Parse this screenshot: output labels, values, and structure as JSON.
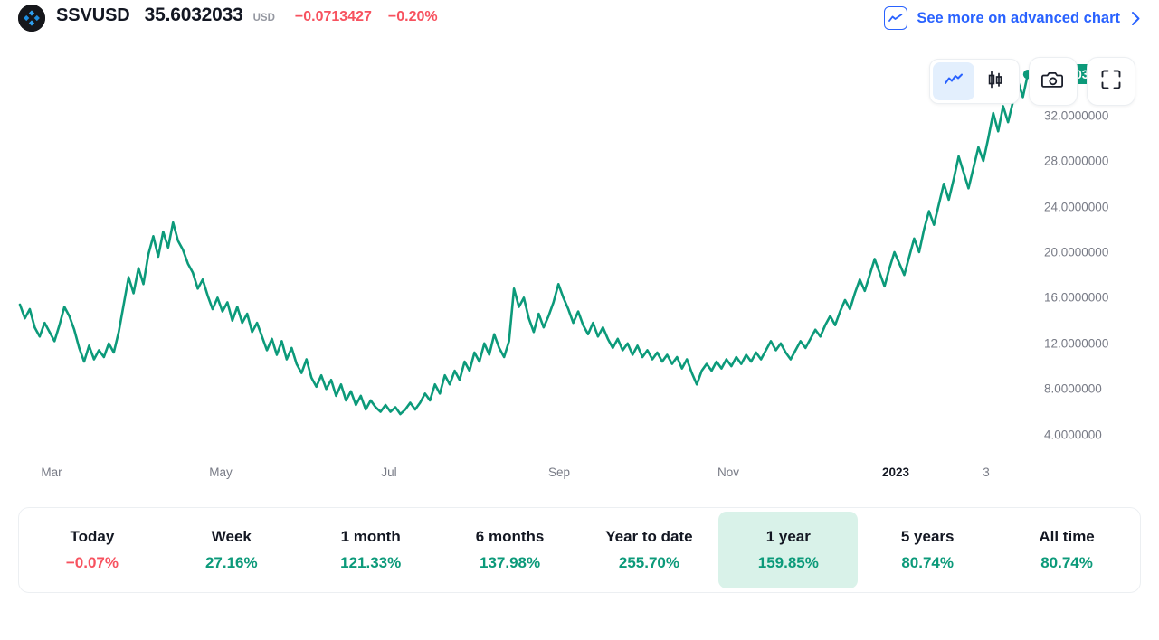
{
  "header": {
    "logo_icon": "ssv-diamond-logo-icon",
    "ticker": "SSVUSD",
    "last_price": "35.6032033",
    "currency": "USD",
    "change_abs": "−0.0713427",
    "change_pct": "−0.20%",
    "change_direction": "negative",
    "advanced_link_label": "See more on advanced chart",
    "advanced_link_icon": "line-chart-icon",
    "advanced_chevron_icon": "chevron-right-icon",
    "link_color": "#2962ff",
    "negative_color": "#f7525f"
  },
  "toolbar": {
    "buttons": [
      {
        "name": "line-chart-type",
        "icon": "line-chart-icon",
        "active": true
      },
      {
        "name": "candles-chart-type",
        "icon": "candlestick-icon",
        "active": false
      },
      {
        "name": "snapshot",
        "icon": "camera-icon",
        "active": false
      },
      {
        "name": "fullscreen",
        "icon": "fullscreen-icon",
        "active": false
      }
    ]
  },
  "chart_data": {
    "type": "line",
    "title": "SSVUSD",
    "xlabel": "",
    "ylabel": "",
    "line_color": "#0c9a7a",
    "grid": false,
    "legend": "none",
    "ylim": [
      2.0,
      37.2
    ],
    "y_ticks": [
      "35.6032033",
      "32.0000000",
      "28.0000000",
      "24.0000000",
      "20.0000000",
      "16.0000000",
      "12.0000000",
      "8.0000000",
      "4.0000000"
    ],
    "y_tick_values": [
      35.6032033,
      32,
      28,
      24,
      20,
      16,
      12,
      8,
      4
    ],
    "current_value_label": "35.6032033",
    "current_value": 35.6032033,
    "x_ticks": [
      "Mar",
      "May",
      "Jul",
      "Sep",
      "Nov",
      "2023",
      "3"
    ],
    "x_tick_bold": [
      false,
      false,
      false,
      false,
      false,
      true,
      false
    ],
    "x_tick_positions": [
      57,
      244,
      430,
      618,
      805,
      990,
      1090
    ],
    "values": [
      15.4,
      14.2,
      15.0,
      13.4,
      12.6,
      13.8,
      13.0,
      12.2,
      13.6,
      15.2,
      14.4,
      13.2,
      11.6,
      10.4,
      11.8,
      10.6,
      11.4,
      10.8,
      12.0,
      11.2,
      13.0,
      15.4,
      17.8,
      16.4,
      18.6,
      17.2,
      19.8,
      21.4,
      19.6,
      21.8,
      20.4,
      22.6,
      21.0,
      20.2,
      19.0,
      18.2,
      16.8,
      17.6,
      16.2,
      15.0,
      16.0,
      14.8,
      15.6,
      14.0,
      15.2,
      13.8,
      14.6,
      13.0,
      13.8,
      12.6,
      11.4,
      12.4,
      11.0,
      12.2,
      10.6,
      11.6,
      10.2,
      9.4,
      10.6,
      9.0,
      8.2,
      9.2,
      8.0,
      8.8,
      7.4,
      8.4,
      7.0,
      7.8,
      6.6,
      7.4,
      6.2,
      7.0,
      6.4,
      6.0,
      6.6,
      6.0,
      6.4,
      5.8,
      6.2,
      6.8,
      6.2,
      6.8,
      7.6,
      7.0,
      8.4,
      7.6,
      9.2,
      8.4,
      9.6,
      8.8,
      10.4,
      9.6,
      11.2,
      10.4,
      12.0,
      11.0,
      12.8,
      11.6,
      10.8,
      12.2,
      16.8,
      15.2,
      16.0,
      14.2,
      13.0,
      14.6,
      13.4,
      14.4,
      15.6,
      17.2,
      16.0,
      15.0,
      13.8,
      14.8,
      13.6,
      12.8,
      13.8,
      12.6,
      13.4,
      12.4,
      11.6,
      12.4,
      11.4,
      12.0,
      11.0,
      11.8,
      10.8,
      11.4,
      10.6,
      11.2,
      10.4,
      11.0,
      10.2,
      10.8,
      9.8,
      10.6,
      9.4,
      8.4,
      9.6,
      10.2,
      9.6,
      10.4,
      9.8,
      10.6,
      10.0,
      10.8,
      10.2,
      11.0,
      10.4,
      11.2,
      10.6,
      11.4,
      12.2,
      11.4,
      12.0,
      11.2,
      10.6,
      11.4,
      12.2,
      11.6,
      12.4,
      13.2,
      12.6,
      13.6,
      14.4,
      13.6,
      14.8,
      15.8,
      15.0,
      16.4,
      17.6,
      16.6,
      18.0,
      19.4,
      18.2,
      17.0,
      18.6,
      20.0,
      19.0,
      18.0,
      19.6,
      21.2,
      20.0,
      22.0,
      23.6,
      22.4,
      24.2,
      26.0,
      24.6,
      26.4,
      28.4,
      27.0,
      25.6,
      27.4,
      29.2,
      28.0,
      30.0,
      32.2,
      30.6,
      32.8,
      31.4,
      33.2,
      35.0,
      33.6,
      35.6032033
    ]
  },
  "performance": {
    "items": [
      {
        "label": "Today",
        "value": "−0.07%",
        "positive": false,
        "active": false
      },
      {
        "label": "Week",
        "value": "27.16%",
        "positive": true,
        "active": false
      },
      {
        "label": "1 month",
        "value": "121.33%",
        "positive": true,
        "active": false
      },
      {
        "label": "6 months",
        "value": "137.98%",
        "positive": true,
        "active": false
      },
      {
        "label": "Year to date",
        "value": "255.70%",
        "positive": true,
        "active": false
      },
      {
        "label": "1 year",
        "value": "159.85%",
        "positive": true,
        "active": true
      },
      {
        "label": "5 years",
        "value": "80.74%",
        "positive": true,
        "active": false
      },
      {
        "label": "All time",
        "value": "80.74%",
        "positive": true,
        "active": false
      }
    ]
  }
}
